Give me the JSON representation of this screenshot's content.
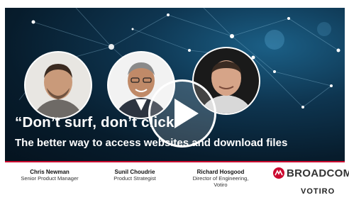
{
  "video": {
    "quote": "“Don’t surf, don’t click”",
    "subtitle": "The better way to access websites and download files"
  },
  "speakers": [
    {
      "name": "Chris Newman",
      "title": "Senior Product Manager"
    },
    {
      "name": "Sunil Choudrie",
      "title": "Product Strategist"
    },
    {
      "name": "Richard Hosgood",
      "title": "Director of Engineering,",
      "title2": "Votiro"
    }
  ],
  "brands": {
    "primary": "BROADCOM",
    "secondary": "VOTIRO"
  },
  "colors": {
    "accent": "#cc092f",
    "background_dark": "#071c2c",
    "highlight": "#1b5f86"
  },
  "icons": {
    "play": "play-icon",
    "broadcom_logo": "broadcom-logo-icon"
  }
}
